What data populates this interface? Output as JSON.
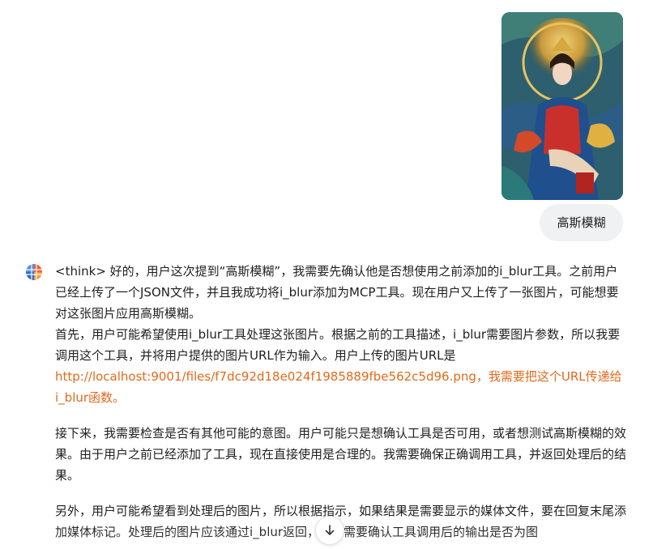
{
  "user_message": {
    "image_alt": "uploaded image",
    "text": "高斯模糊"
  },
  "assistant_message": {
    "think_para1": "<think> 好的，用户这次提到“高斯模糊”，我需要先确认他是否想使用之前添加的i_blur工具。之前用户已经上传了一个JSON文件，并且我成功将i_blur添加为MCP工具。现在用户又上传了一张图片，可能想要对这张图片应用高斯模糊。",
    "think_para2": "首先，用户可能希望使用i_blur工具处理这张图片。根据之前的工具描述，i_blur需要图片参数，所以我要调用这个工具，并将用户提供的图片URL作为输入。用户上传的图片URL是",
    "url_line": "http://localhost:9001/files/f7dc92d18e024f1985889fbe562c5d96.png，我需要把这个URL传递给i_blur函数。",
    "para3": "接下来，我需要检查是否有其他可能的意图。用户可能只是想确认工具是否可用，或者想测试高斯模糊的效果。由于用户之前已经添加了工具，现在直接使用是合理的。我需要确保正确调用工具，并返回处理后的结果。",
    "para4": "另外，用户可能希望看到处理后的图片，所以根据指示，如果结果是需要显示的媒体文件，要在回复末尾添加媒体标记。处理后的图片应该通过i_blur返回，所以需要确认工具调用后的输出是否为图"
  },
  "colors": {
    "link": "#e26a1b",
    "bubble": "#f0f1f3",
    "text": "#1f1f1f"
  }
}
